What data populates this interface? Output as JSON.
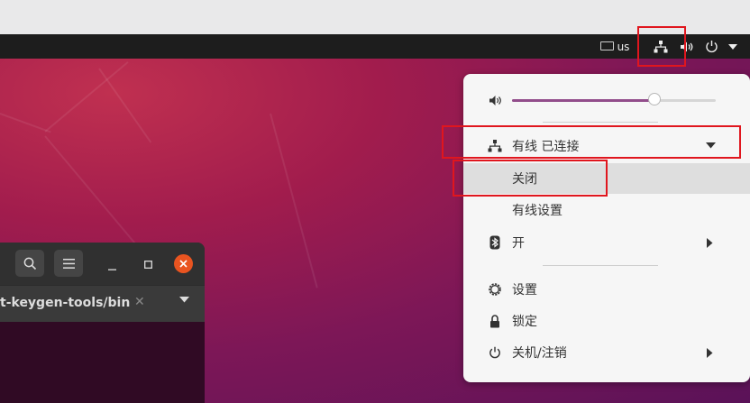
{
  "panel": {
    "keyboard_layout": "us",
    "icons": [
      "keyboard-icon",
      "network-wired-icon",
      "volume-icon",
      "power-icon",
      "dropdown-arrow-icon"
    ]
  },
  "terminal": {
    "tab_title": "t-keygen-tools/bin",
    "icons": [
      "search-icon",
      "hamburger-menu-icon",
      "minimize-icon",
      "maximize-icon",
      "close-icon"
    ],
    "close_color": "#e95420"
  },
  "system_menu": {
    "volume_level": 0.7,
    "wired": {
      "label": "有线 已连接",
      "submenu": {
        "off": "关闭",
        "settings": "有线设置"
      }
    },
    "bluetooth": {
      "label": "开"
    },
    "settings": {
      "label": "设置"
    },
    "lock": {
      "label": "锁定"
    },
    "power": {
      "label": "关机/注销"
    },
    "accent": "#924d8b"
  },
  "highlight_color": "#e0161e"
}
